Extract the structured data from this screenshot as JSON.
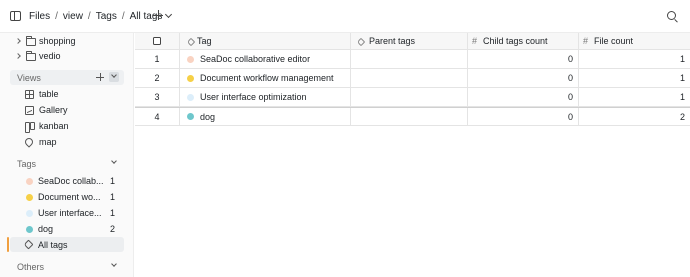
{
  "header": {
    "breadcrumb": [
      "Files",
      "view",
      "Tags",
      "All tags"
    ],
    "separator": "/"
  },
  "sidebar": {
    "folders": [
      {
        "label": "shopping"
      },
      {
        "label": "vedio"
      }
    ],
    "views_title": "Views",
    "views": [
      {
        "label": "table",
        "icon": "table-icon"
      },
      {
        "label": "Gallery",
        "icon": "gallery-icon"
      },
      {
        "label": "kanban",
        "icon": "kanban-icon"
      },
      {
        "label": "map",
        "icon": "map-icon"
      }
    ],
    "tags_title": "Tags",
    "tags": [
      {
        "label": "SeaDoc collab...",
        "count": "1",
        "color": "#f9d3c2"
      },
      {
        "label": "Document wo...",
        "count": "1",
        "color": "#f6d047"
      },
      {
        "label": "User interface...",
        "count": "1",
        "color": "#dceefa"
      },
      {
        "label": "dog",
        "count": "2",
        "color": "#6ec7cc"
      }
    ],
    "all_tags_label": "All tags",
    "others_title": "Others",
    "active_color": "#f09f3f"
  },
  "table": {
    "columns": [
      "Tag",
      "Parent tags",
      "Child tags count",
      "File count"
    ],
    "rows": [
      {
        "index": "1",
        "tag": "SeaDoc collaborative editor",
        "color": "#f9d3c2",
        "parent": "",
        "child_count": "0",
        "file_count": "1"
      },
      {
        "index": "2",
        "tag": "Document workflow management",
        "color": "#f6d047",
        "parent": "",
        "child_count": "0",
        "file_count": "1"
      },
      {
        "index": "3",
        "tag": "User interface optimization",
        "color": "#dceefa",
        "parent": "",
        "child_count": "0",
        "file_count": "1"
      },
      {
        "index": "4",
        "tag": "dog",
        "color": "#6ec7cc",
        "parent": "",
        "child_count": "0",
        "file_count": "2"
      }
    ]
  }
}
